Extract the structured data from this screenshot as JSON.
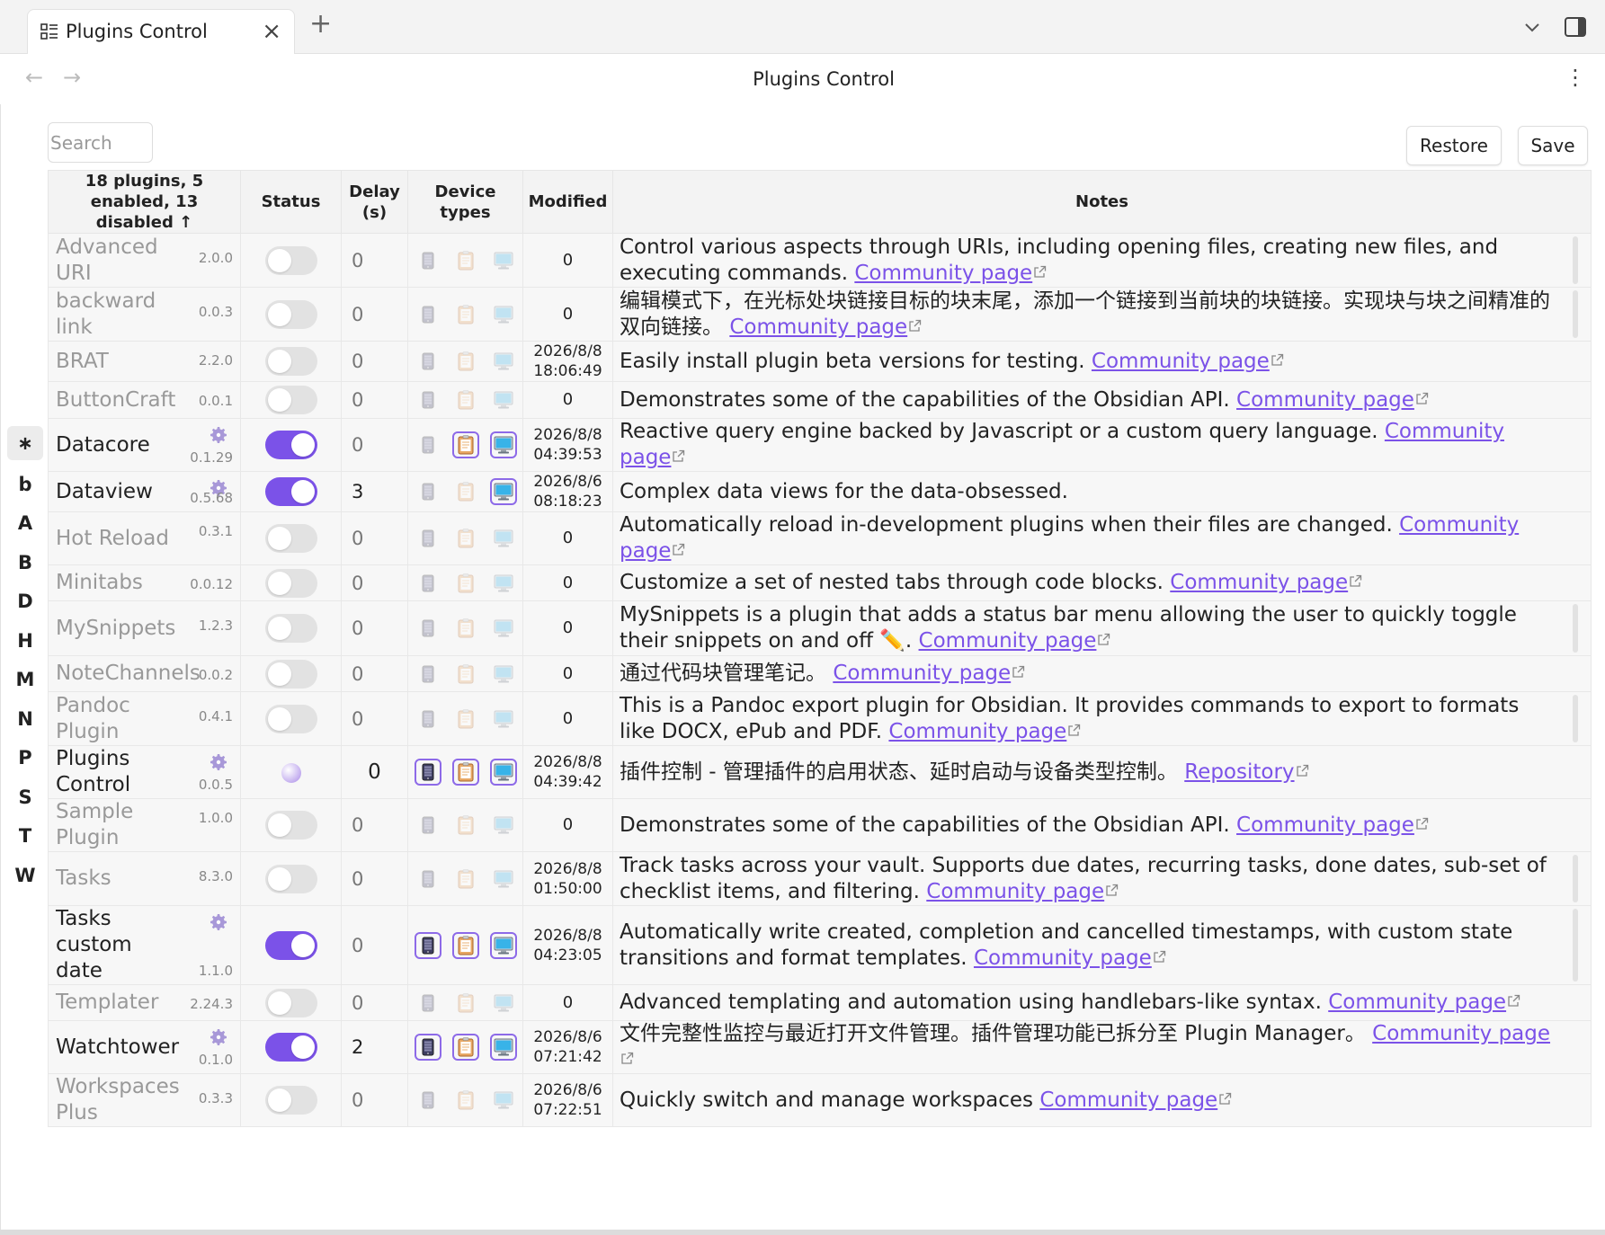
{
  "tab": {
    "title": "Plugins Control",
    "icon": "plugin-list-icon"
  },
  "nav": {
    "title": "Plugins Control"
  },
  "toolbar": {
    "search_placeholder": "Search",
    "restore_label": "Restore",
    "save_label": "Save"
  },
  "alpha_index": [
    "∗",
    "b",
    "A",
    "B",
    "D",
    "H",
    "M",
    "N",
    "P",
    "S",
    "T",
    "W"
  ],
  "columns": {
    "summary": "18 plugins, 5 enabled, 13 disabled ↑",
    "status": "Status",
    "delay": "Delay (s)",
    "device": "Device types",
    "modified": "Modified",
    "notes": "Notes"
  },
  "colors": {
    "accent": "#7b52e8",
    "toggle_off": "#e2e2e2"
  },
  "link_texts": {
    "community": "Community page",
    "repo": "Repository"
  },
  "plugins": [
    {
      "name": "Advanced URI",
      "version": "2.0.0",
      "enabled": false,
      "delay": "0",
      "modified": [
        "0"
      ],
      "notes": "Control various aspects through URIs, including opening files, creating new files, and executing commands. ",
      "link": "Community page",
      "devices": [
        false,
        false,
        false
      ]
    },
    {
      "name": "backward link",
      "version": "0.0.3",
      "enabled": false,
      "delay": "0",
      "modified": [
        "0"
      ],
      "notes": "编辑模式下，在光标处块链接目标的块末尾，添加一个链接到当前块的块链接。实现块与块之间精准的双向链接。 ",
      "link": "Community page",
      "devices": [
        false,
        false,
        false
      ]
    },
    {
      "name": "BRAT",
      "version": "2.2.0",
      "enabled": false,
      "delay": "0",
      "modified": [
        "2026/8/8",
        "18:06:49"
      ],
      "notes": "Easily install plugin beta versions for testing. ",
      "link": "Community page",
      "devices": [
        false,
        false,
        false
      ]
    },
    {
      "name": "ButtonCraft",
      "version": "0.0.1",
      "enabled": false,
      "delay": "0",
      "modified": [
        "0"
      ],
      "notes": "Demonstrates some of the capabilities of the Obsidian API. ",
      "link": "Community page",
      "devices": [
        false,
        false,
        false
      ]
    },
    {
      "name": "Datacore",
      "version": "0.1.29",
      "enabled": true,
      "settings": true,
      "delay": "0",
      "modified": [
        "2026/8/8",
        "04:39:53"
      ],
      "notes": "Reactive query engine backed by Javascript or a custom query language. ",
      "link": "Community page",
      "devices": [
        false,
        true,
        true
      ]
    },
    {
      "name": "Dataview",
      "version": "0.5.68",
      "enabled": true,
      "settings": true,
      "delay": "3",
      "modified": [
        "2026/8/6",
        "08:18:23"
      ],
      "notes": "Complex data views for the data-obsessed.",
      "link": "",
      "devices": [
        false,
        false,
        true
      ]
    },
    {
      "name": "Hot Reload",
      "version": "0.3.1",
      "enabled": false,
      "delay": "0",
      "modified": [
        "0"
      ],
      "notes": "Automatically reload in-development plugins when their files are changed. ",
      "link": "Community page",
      "devices": [
        false,
        false,
        false
      ]
    },
    {
      "name": "Minitabs",
      "version": "0.0.12",
      "enabled": false,
      "delay": "0",
      "modified": [
        "0"
      ],
      "notes": "Customize a set of nested tabs through code blocks. ",
      "link": "Community page",
      "devices": [
        false,
        false,
        false
      ]
    },
    {
      "name": "MySnippets",
      "version": "1.2.3",
      "enabled": false,
      "delay": "0",
      "modified": [
        "0"
      ],
      "notes": "MySnippets is a plugin that adds a status bar menu allowing the user to quickly toggle their snippets on and off ✏️. ",
      "link": "Community page",
      "devices": [
        false,
        false,
        false
      ]
    },
    {
      "name": "NoteChannels",
      "version": "0.0.2",
      "enabled": false,
      "delay": "0",
      "modified": [
        "0"
      ],
      "notes": "通过代码块管理笔记。 ",
      "link": "Community page",
      "devices": [
        false,
        false,
        false
      ]
    },
    {
      "name": "Pandoc Plugin",
      "version": "0.4.1",
      "enabled": false,
      "delay": "0",
      "modified": [
        "0"
      ],
      "notes": "This is a Pandoc export plugin for Obsidian. It provides commands to export to formats like DOCX, ePub and PDF. ",
      "link": "Community page",
      "devices": [
        false,
        false,
        false
      ]
    },
    {
      "name": "Plugins Control",
      "version": "0.0.5",
      "enabled": true,
      "self": true,
      "settings": true,
      "delay": "0",
      "modified": [
        "2026/8/8",
        "04:39:42"
      ],
      "notes": "插件控制 - 管理插件的启用状态、延时启动与设备类型控制。 ",
      "link": "Repository",
      "devices": [
        true,
        true,
        true
      ]
    },
    {
      "name": "Sample Plugin",
      "version": "1.0.0",
      "enabled": false,
      "delay": "0",
      "modified": [
        "0"
      ],
      "notes": "Demonstrates some of the capabilities of the Obsidian API. ",
      "link": "Community page",
      "devices": [
        false,
        false,
        false
      ]
    },
    {
      "name": "Tasks",
      "version": "8.3.0",
      "enabled": false,
      "delay": "0",
      "modified": [
        "2026/8/8",
        "01:50:00"
      ],
      "notes": "Track tasks across your vault. Supports due dates, recurring tasks, done dates, sub-set of checklist items, and filtering. ",
      "link": "Community page",
      "devices": [
        false,
        false,
        false
      ]
    },
    {
      "name": "Tasks custom date",
      "version": "1.1.0",
      "enabled": true,
      "settings": true,
      "delay": "0",
      "modified": [
        "2026/8/8",
        "04:23:05"
      ],
      "notes": "Automatically write created, completion and cancelled timestamps, with custom state transitions and format templates. ",
      "link": "Community page",
      "devices": [
        true,
        true,
        true
      ]
    },
    {
      "name": "Templater",
      "version": "2.24.3",
      "enabled": false,
      "delay": "0",
      "modified": [
        "0"
      ],
      "notes": "Advanced templating and automation using handlebars-like syntax. ",
      "link": "Community page",
      "devices": [
        false,
        false,
        false
      ]
    },
    {
      "name": "Watchtower",
      "version": "0.1.0",
      "enabled": true,
      "settings": true,
      "delay": "2",
      "modified": [
        "2026/8/6",
        "07:21:42"
      ],
      "notes": "文件完整性监控与最近打开文件管理。插件管理功能已拆分至 Plugin Manager。 ",
      "link": "Community page",
      "devices": [
        true,
        true,
        true
      ]
    },
    {
      "name": "Workspaces Plus",
      "version": "0.3.3",
      "enabled": false,
      "delay": "0",
      "modified": [
        "2026/8/6",
        "07:22:51"
      ],
      "notes": "Quickly switch and manage workspaces ",
      "link": "Community page",
      "devices": [
        false,
        false,
        false
      ]
    }
  ]
}
